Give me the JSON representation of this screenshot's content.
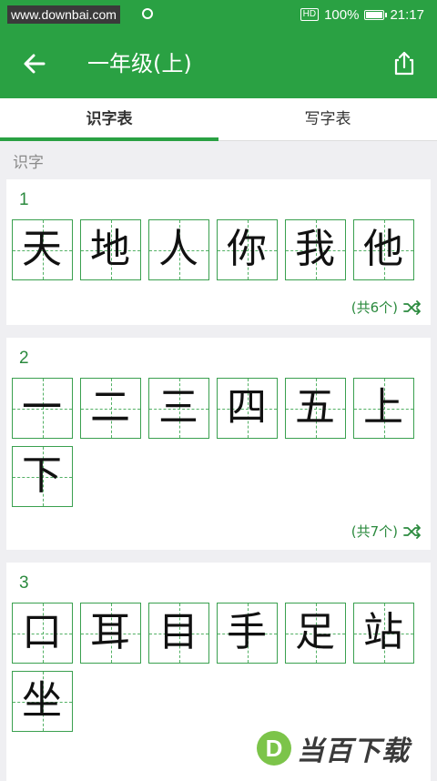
{
  "status_bar": {
    "url_text": "www.downbai.com",
    "hd_badge": "HD",
    "battery_text": "100%",
    "battery_level_percent": 100,
    "time": "21:17"
  },
  "app_bar": {
    "title": "一年级(上)"
  },
  "tabs": [
    {
      "label": "识字表",
      "active": true
    },
    {
      "label": "写字表",
      "active": false
    }
  ],
  "section_label": "识字",
  "groups": [
    {
      "number": "1",
      "chars": [
        "天",
        "地",
        "人",
        "你",
        "我",
        "他"
      ],
      "count_text": "(共6个)"
    },
    {
      "number": "2",
      "chars": [
        "一",
        "二",
        "三",
        "四",
        "五",
        "上",
        "下"
      ],
      "count_text": "(共7个)"
    },
    {
      "number": "3",
      "chars": [
        "口",
        "耳",
        "目",
        "手",
        "足",
        "站",
        "坐"
      ],
      "count_text": ""
    }
  ],
  "watermark": {
    "logo_letter": "D",
    "text": "当百下载"
  },
  "colors": {
    "primary": "#2aa143",
    "accent_text": "#2b8a3e",
    "grid_line": "#3aa04f",
    "background": "#efeff2"
  },
  "icons": {
    "back": "arrow-left-icon",
    "share": "share-icon",
    "shuffle": "shuffle-icon"
  }
}
